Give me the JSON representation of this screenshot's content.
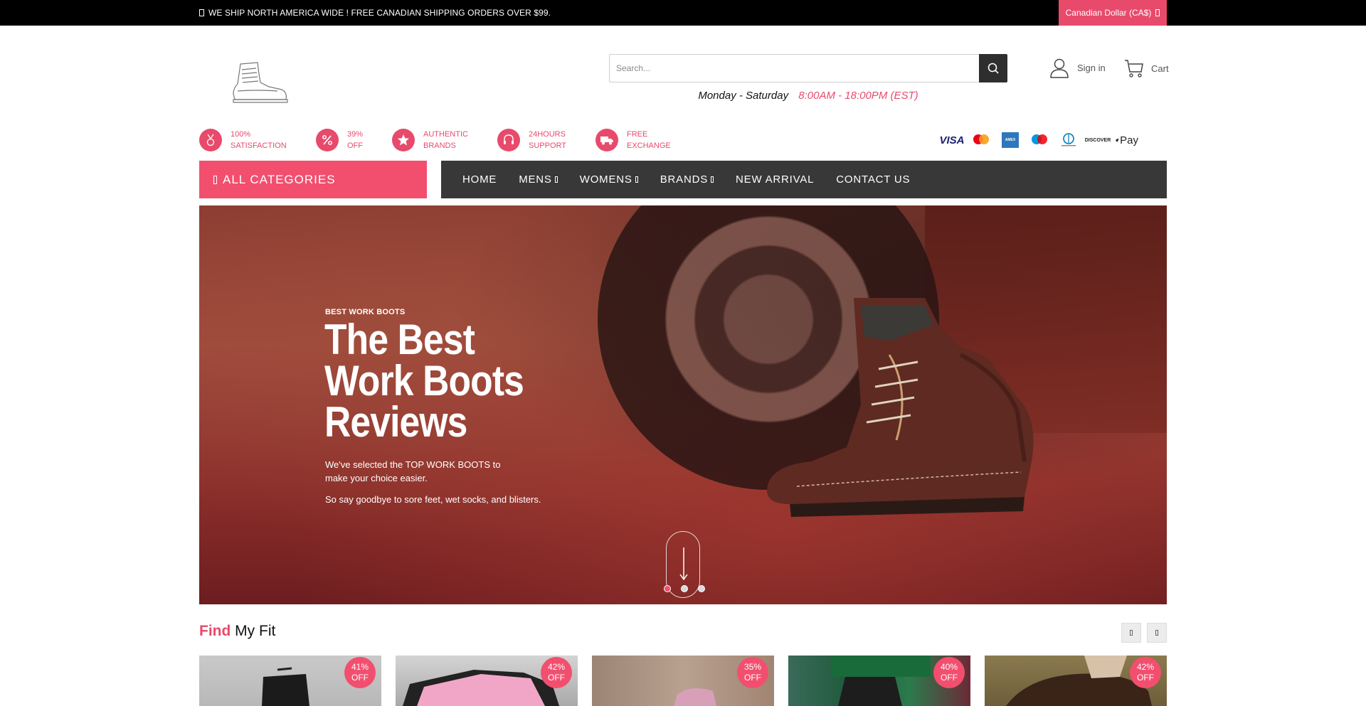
{
  "topbar": {
    "shipping_message": "WE SHIP NORTH AMERICA WIDE ! FREE CANADIAN SHIPPING ORDERS OVER $99.",
    "currency": "Canadian Dollar (CA$)"
  },
  "header": {
    "search_placeholder": "Search...",
    "hours_days": "Monday - Saturday",
    "hours_time": "8:00AM - 18:00PM (EST)",
    "signin_label": "Sign in",
    "cart_label": "Cart"
  },
  "features": [
    {
      "line1": "100%",
      "line2": "SATISFACTION",
      "icon": "medal-icon"
    },
    {
      "line1": "39%",
      "line2": "OFF",
      "icon": "percent-icon"
    },
    {
      "line1": "AUTHENTIC",
      "line2": "BRANDS",
      "icon": "star-icon"
    },
    {
      "line1": "24HOURS",
      "line2": "SUPPORT",
      "icon": "headset-icon"
    },
    {
      "line1": "FREE",
      "line2": "EXCHANGE",
      "icon": "truck-icon"
    }
  ],
  "payments": [
    "VISA",
    "mastercard",
    "AMEX",
    "maestro",
    "Diners Club",
    "DISCOVER",
    "Pay"
  ],
  "nav": {
    "all_categories": "ALL CATEGORIES",
    "items": [
      {
        "label": "HOME",
        "dropdown": false
      },
      {
        "label": "MENS",
        "dropdown": true
      },
      {
        "label": "WOMENS",
        "dropdown": true
      },
      {
        "label": "BRANDS",
        "dropdown": true
      },
      {
        "label": "NEW ARRIVAL",
        "dropdown": false
      },
      {
        "label": "CONTACT US",
        "dropdown": false
      }
    ]
  },
  "hero": {
    "eyebrow": "BEST WORK BOOTS",
    "headline_1": "The Best",
    "headline_2": "Work Boots",
    "headline_3": "Reviews",
    "sub_1": "We've selected the TOP WORK BOOTS to",
    "sub_2": "make your choice easier.",
    "sub_3": "So say goodbye to sore feet, wet socks, and blisters.",
    "slides": 3,
    "active_slide": 1
  },
  "fit": {
    "title_accent": "Find",
    "title_rest": "My Fit",
    "products": [
      {
        "pct": "41%",
        "off": "OFF"
      },
      {
        "pct": "42%",
        "off": "OFF"
      },
      {
        "pct": "35%",
        "off": "OFF"
      },
      {
        "pct": "40%",
        "off": "OFF"
      },
      {
        "pct": "42%",
        "off": "OFF"
      }
    ]
  },
  "colors": {
    "accent": "#e84a6c",
    "nav_bg": "#383838",
    "topbar_bg": "#000000"
  }
}
